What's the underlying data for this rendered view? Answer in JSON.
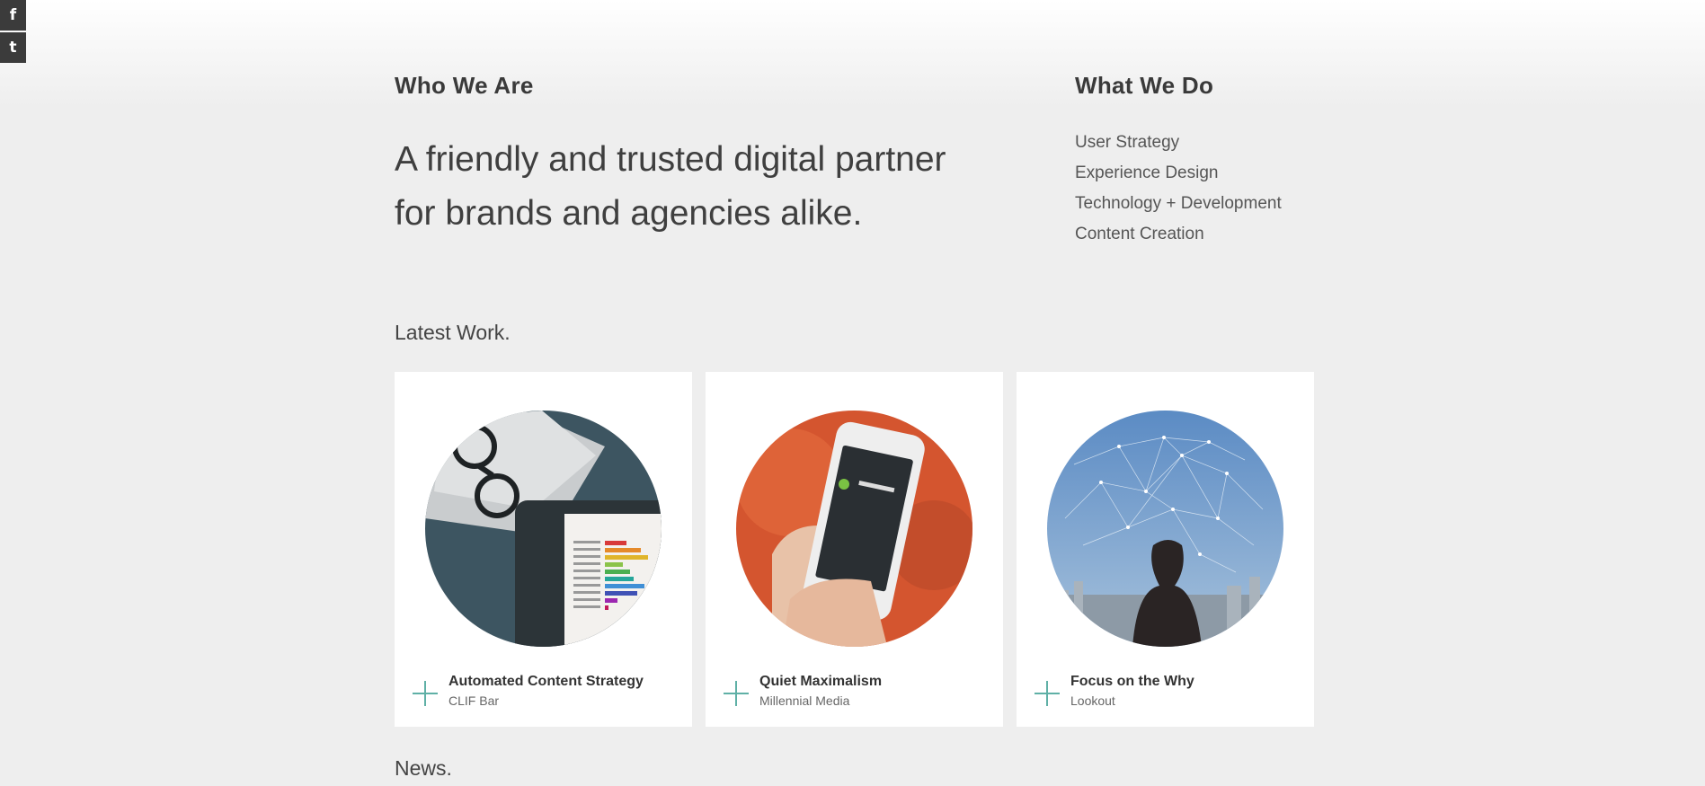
{
  "social": {
    "facebook_glyph": "f",
    "twitter_glyph": "t"
  },
  "who": {
    "heading": "Who We Are",
    "tagline_line1": "A friendly and trusted digital partner",
    "tagline_line2": "for brands and agencies alike."
  },
  "what": {
    "heading": "What We Do",
    "items": [
      "User Strategy",
      "Experience Design",
      "Technology + Development",
      "Content Creation"
    ]
  },
  "latest": {
    "heading": "Latest Work.",
    "cards": [
      {
        "title": "Automated Content Strategy",
        "client": "CLIF Bar"
      },
      {
        "title": "Quiet Maximalism",
        "client": "Millennial Media"
      },
      {
        "title": "Focus on the Why",
        "client": "Lookout"
      }
    ]
  },
  "news": {
    "heading": "News."
  },
  "colors": {
    "accent": "#5fb0a6",
    "background": "#eeeeee",
    "social_bg": "#3b3b3b"
  }
}
